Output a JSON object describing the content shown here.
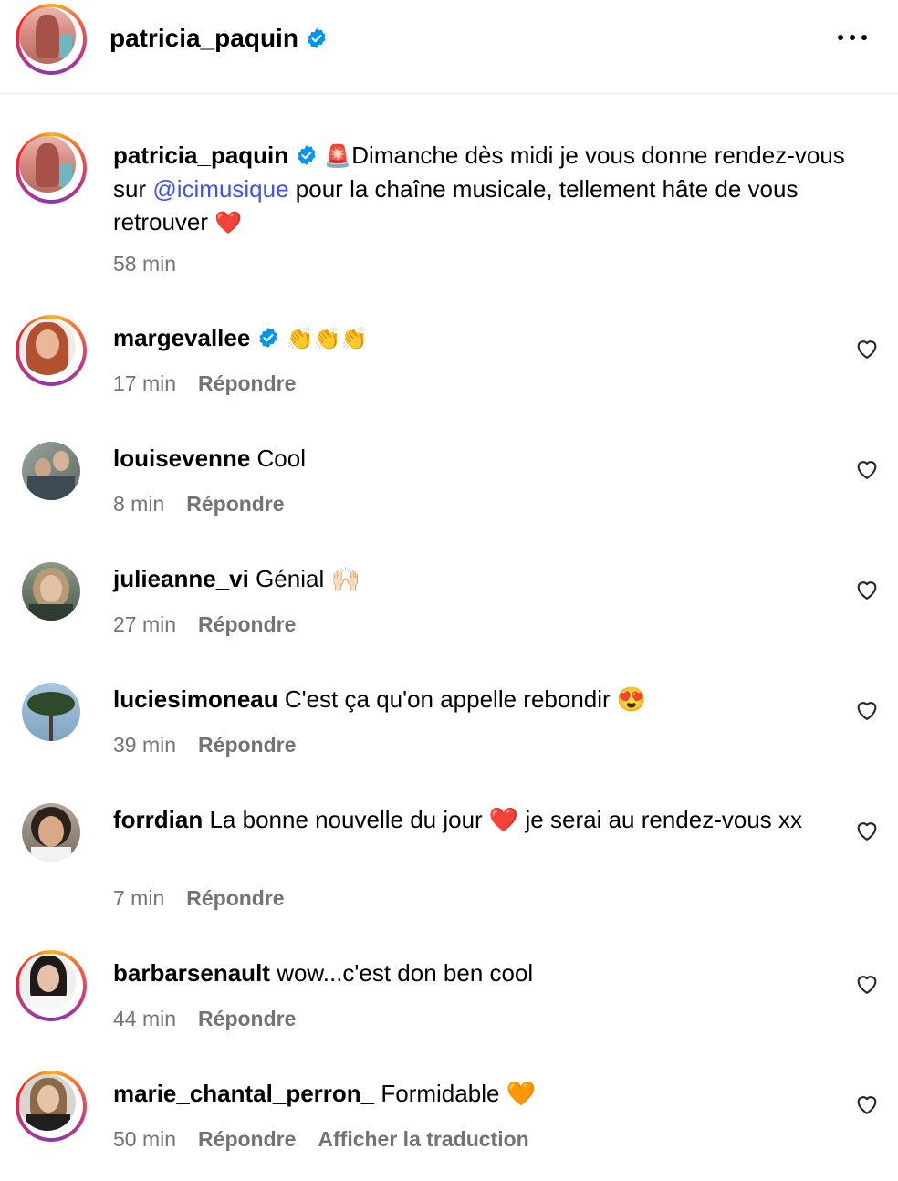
{
  "header": {
    "username": "patricia_paquin",
    "more_icon": "more-horizontal-icon"
  },
  "post": {
    "username": "patricia_paquin",
    "emoji_prefix": "🚨",
    "text_before_mention": "Dimanche dès midi je vous donne rendez-vous sur ",
    "mention": "@icimusique",
    "text_after_mention": " pour la chaîne musicale, tellement hâte de vous retrouver ",
    "emoji_suffix": "❤️",
    "time": "58 min"
  },
  "comments": [
    {
      "username": "margevallee",
      "verified": true,
      "text": "👏👏👏",
      "time": "17 min",
      "reply": "Répondre"
    },
    {
      "username": "louisevenne",
      "text": "Cool",
      "time": "8 min",
      "reply": "Répondre"
    },
    {
      "username": "julieanne_vi",
      "text": "Génial 🙌🏻",
      "time": "27 min",
      "reply": "Répondre"
    },
    {
      "username": "luciesimoneau",
      "text": "C'est ça qu'on appelle rebondir 😍",
      "time": "39 min",
      "reply": "Répondre"
    },
    {
      "username": "forrdian",
      "text": "La bonne nouvelle du jour ❤️ je serai au rendez-vous xx",
      "time": "7 min",
      "reply": "Répondre"
    },
    {
      "username": "barbarsenault",
      "text": "wow...c'est don ben cool",
      "time": "44 min",
      "reply": "Répondre"
    },
    {
      "username": "marie_chantal_perron_",
      "text": "Formidable 🧡",
      "time": "50 min",
      "reply": "Répondre",
      "translate": "Afficher la traduction"
    }
  ],
  "colors": {
    "mention": "#4150f7",
    "meta": "#737373",
    "verified": "#0095f6"
  }
}
